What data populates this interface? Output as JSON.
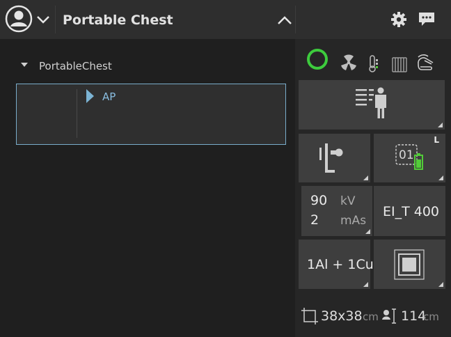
{
  "header": {
    "title": "Portable Chest",
    "icons": [
      "user-avatar-icon",
      "chevron-down-icon",
      "chevron-up-icon",
      "gear-icon",
      "chat-icon"
    ]
  },
  "tree": {
    "root_label": "PortableChest",
    "view_label": "AP"
  },
  "status_icons": [
    "status-ring-icon",
    "radiation-icon",
    "temperature-icon",
    "grid-icon",
    "hand-icon"
  ],
  "tiles": {
    "patient_info": {
      "icon": "patient-list-icon"
    },
    "stand": {
      "icon": "wall-stand-icon"
    },
    "detector": {
      "number": "01",
      "side": "L",
      "icon": "detector-battery-icon"
    },
    "exposure": {
      "kv_value": "90",
      "kv_unit": "kV",
      "mas_value": "2",
      "mas_unit": "mAs"
    },
    "ei_target": {
      "label": "EI_T 400"
    },
    "filter": {
      "label": "1Al + 1Cu"
    },
    "collimation": {
      "icon": "collimation-square-icon"
    }
  },
  "footer": {
    "field_size": "38x38",
    "field_unit": "cm",
    "sid": "114",
    "sid_unit": "cm"
  },
  "colors": {
    "accent_green": "#3dcb3d",
    "selection_blue": "#7aaecc",
    "tile": "#3e3e3e"
  }
}
